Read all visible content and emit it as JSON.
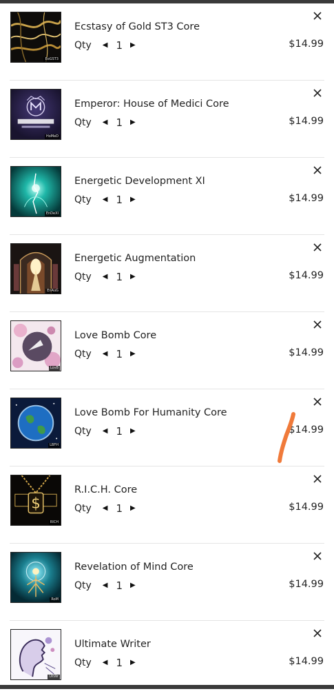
{
  "cart": {
    "qty_label": "Qty",
    "decrement_glyph": "◀",
    "increment_glyph": "▶",
    "remove_icon": "close-icon",
    "items": [
      {
        "name": "Ecstasy of Gold ST3 Core",
        "qty": "1",
        "price": "$14.99",
        "tag": "EoGST3",
        "art": "gold-marble"
      },
      {
        "name": "Emperor: House of Medici Core",
        "qty": "1",
        "price": "$14.99",
        "tag": "HoMeD",
        "art": "medici-crest"
      },
      {
        "name": "Energetic Development XI",
        "qty": "1",
        "price": "$14.99",
        "tag": "EnDeXI",
        "art": "teal-energy"
      },
      {
        "name": "Energetic Augmentation",
        "qty": "1",
        "price": "$14.99",
        "tag": "EnAuG",
        "art": "cathedral-light"
      },
      {
        "name": "Love Bomb Core",
        "qty": "1",
        "price": "$14.99",
        "tag": "LovB",
        "art": "pink-floral"
      },
      {
        "name": "Love Bomb For Humanity Core",
        "qty": "1",
        "price": "$14.99",
        "tag": "LBFH",
        "art": "earth-globe"
      },
      {
        "name": "R.I.C.H. Core",
        "qty": "1",
        "price": "$14.99",
        "tag": "RICH",
        "art": "gold-dollar-chain"
      },
      {
        "name": "Revelation of Mind Core",
        "qty": "1",
        "price": "$14.99",
        "tag": "RoM",
        "art": "mind-tree"
      },
      {
        "name": "Ultimate Writer",
        "qty": "1",
        "price": "$14.99",
        "tag": "UltWr",
        "art": "ink-profile"
      }
    ]
  },
  "colors": {
    "text": "#222222",
    "divider": "#e4e4e4",
    "scribble": "#f07a3a",
    "chrome": "#3a3a3a"
  }
}
